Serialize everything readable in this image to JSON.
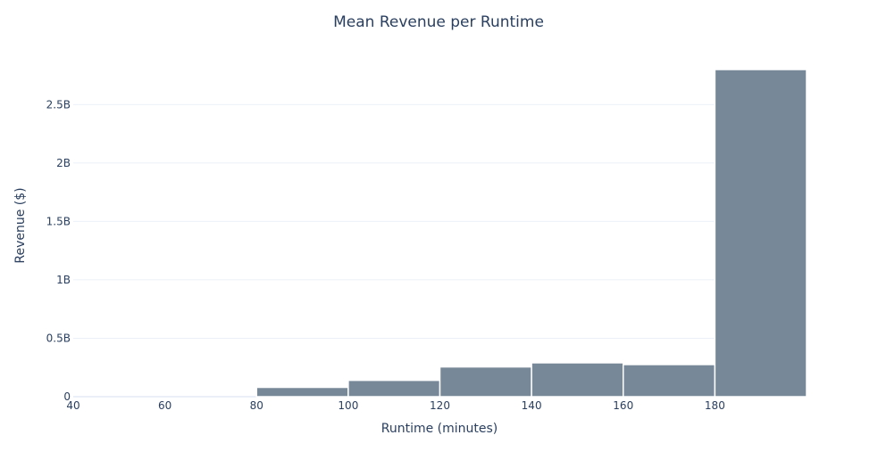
{
  "chart_data": {
    "type": "bar",
    "title": "Mean Revenue per Runtime",
    "xlabel": "Runtime (minutes)",
    "ylabel": "Revenue ($)",
    "bins": [
      {
        "x0": 40,
        "x1": 60,
        "value": 0
      },
      {
        "x0": 60,
        "x1": 80,
        "value": 0
      },
      {
        "x0": 80,
        "x1": 100,
        "value": 80000000
      },
      {
        "x0": 100,
        "x1": 120,
        "value": 140000000
      },
      {
        "x0": 120,
        "x1": 140,
        "value": 255000000
      },
      {
        "x0": 140,
        "x1": 160,
        "value": 290000000
      },
      {
        "x0": 160,
        "x1": 180,
        "value": 275000000
      },
      {
        "x0": 180,
        "x1": 200,
        "value": 2800000000
      }
    ],
    "xlim": [
      40,
      200
    ],
    "ylim": [
      0,
      2800000000
    ],
    "x_ticks": [
      {
        "value": 40,
        "label": "40"
      },
      {
        "value": 60,
        "label": "60"
      },
      {
        "value": 80,
        "label": "80"
      },
      {
        "value": 100,
        "label": "100"
      },
      {
        "value": 120,
        "label": "120"
      },
      {
        "value": 140,
        "label": "140"
      },
      {
        "value": 160,
        "label": "160"
      },
      {
        "value": 180,
        "label": "180"
      }
    ],
    "y_ticks": [
      {
        "value": 0,
        "label": "0"
      },
      {
        "value": 500000000,
        "label": "0.5B"
      },
      {
        "value": 1000000000,
        "label": "1B"
      },
      {
        "value": 1500000000,
        "label": "1.5B"
      },
      {
        "value": 2000000000,
        "label": "2B"
      },
      {
        "value": 2500000000,
        "label": "2.5B"
      }
    ],
    "grid": true,
    "legend": "none",
    "colors": {
      "bar": "#778899",
      "text": "#2a3f5f",
      "grid": "#ebf0f8",
      "background": "#ffffff"
    }
  }
}
